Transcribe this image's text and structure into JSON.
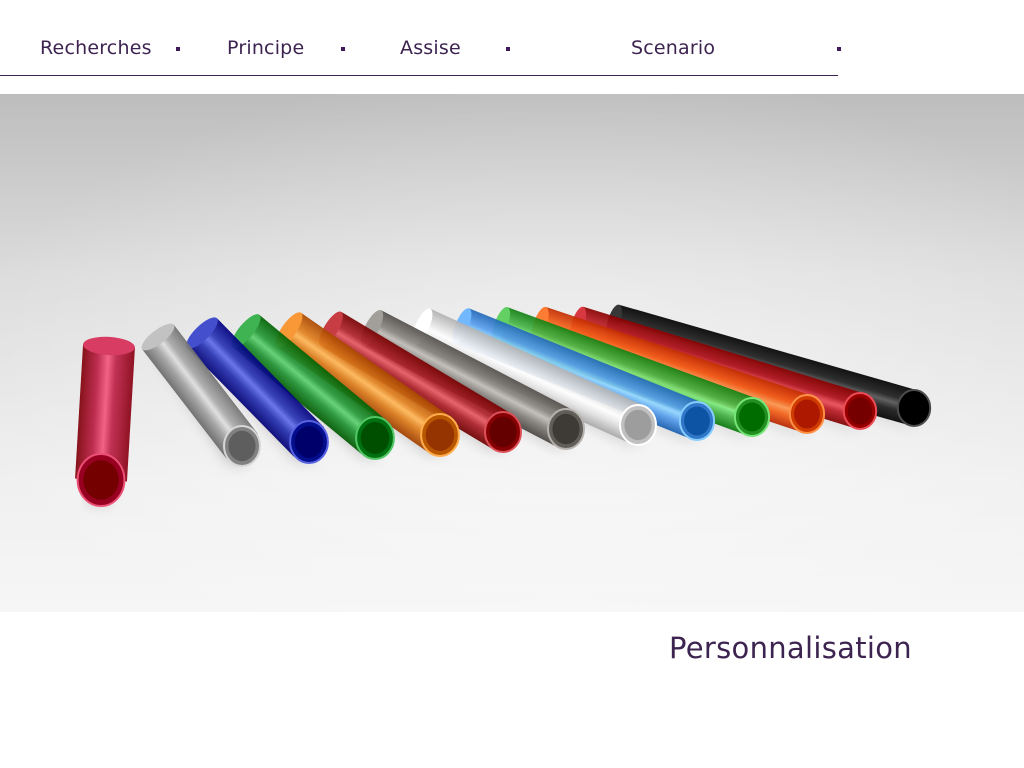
{
  "nav": {
    "items": [
      {
        "label": "Recherches"
      },
      {
        "label": "Principe"
      },
      {
        "label": "Assise"
      },
      {
        "label": "Scenario"
      }
    ]
  },
  "hero": {
    "tubes": [
      {
        "color": "#b0143a",
        "name": "red-translucent"
      },
      {
        "color": "#9a9a9a",
        "name": "clear"
      },
      {
        "color": "#1c27a6",
        "name": "blue"
      },
      {
        "color": "#178a2a",
        "name": "green"
      },
      {
        "color": "#d1700f",
        "name": "orange-translucent"
      },
      {
        "color": "#a0141c",
        "name": "dark-red"
      },
      {
        "color": "#7a7672",
        "name": "smoke"
      },
      {
        "color": "#d9d9d9",
        "name": "white"
      },
      {
        "color": "#4a90e0",
        "name": "light-blue"
      },
      {
        "color": "#3aa83a",
        "name": "bright-green"
      },
      {
        "color": "#e8540c",
        "name": "bright-orange"
      },
      {
        "color": "#b0101a",
        "name": "red"
      },
      {
        "color": "#101010",
        "name": "black"
      }
    ]
  },
  "caption": {
    "text": "Personnalisation"
  },
  "colors": {
    "accent": "#3d2450",
    "dot": "#3d1a5a"
  }
}
